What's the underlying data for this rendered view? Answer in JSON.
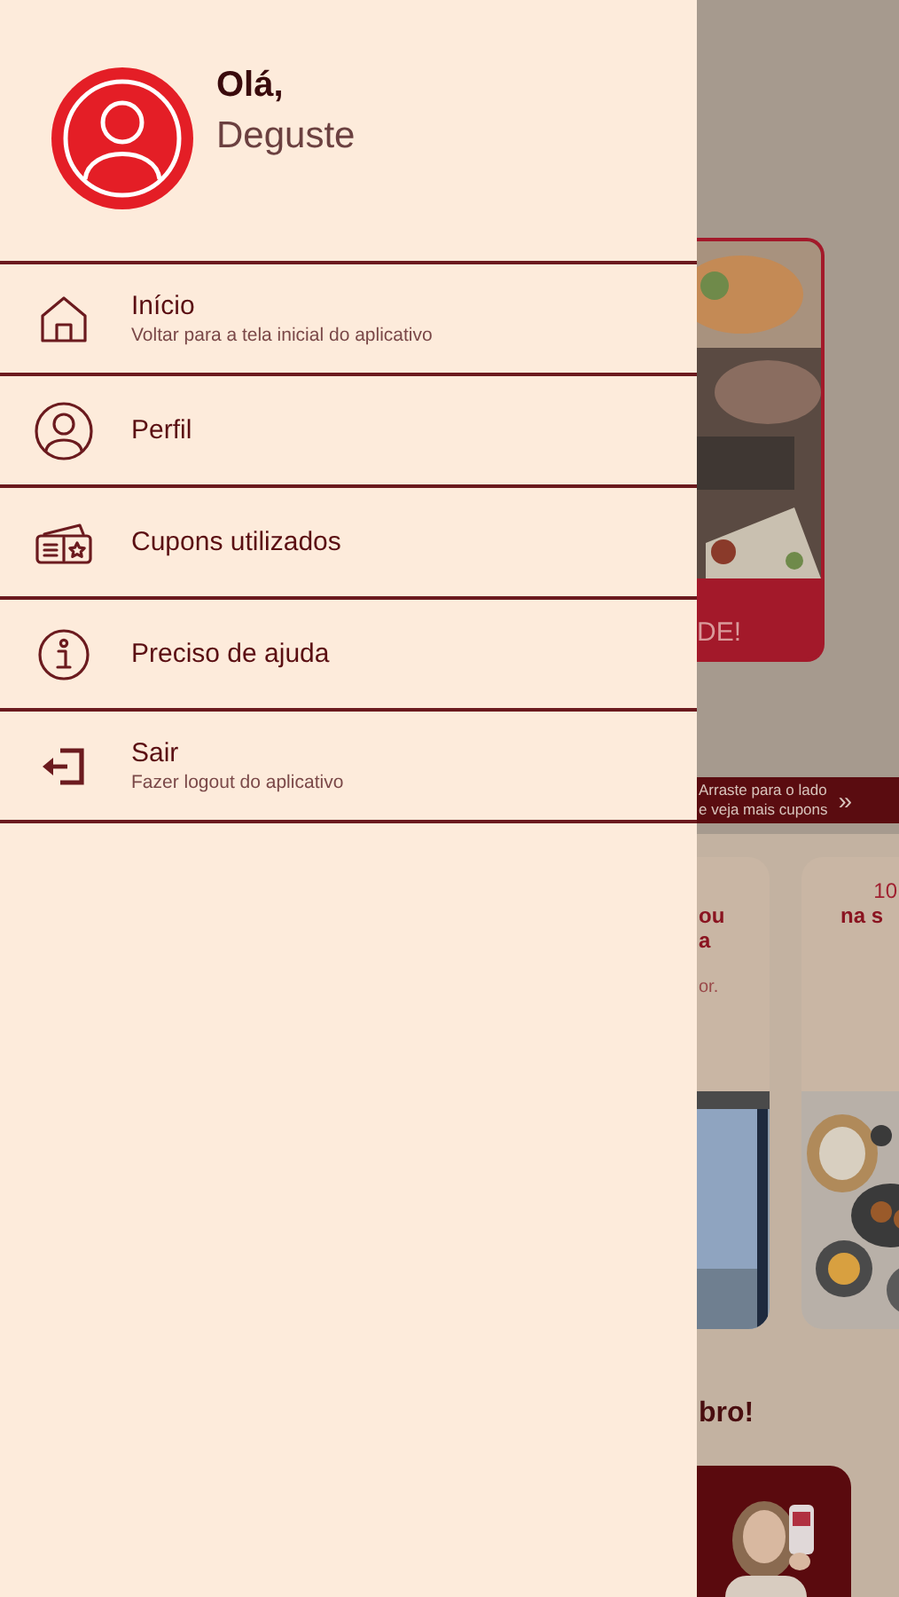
{
  "drawer": {
    "greeting": "Olá,",
    "user_name": "Deguste",
    "items": [
      {
        "kind": "home",
        "label": "Início",
        "subtitle": "Voltar para a tela inicial do aplicativo"
      },
      {
        "kind": "profile",
        "label": "Perfil"
      },
      {
        "kind": "coupons",
        "label": "Cupons utilizados"
      },
      {
        "kind": "info",
        "label": "Preciso de ajuda"
      },
      {
        "kind": "logout",
        "label": "Sair",
        "subtitle": "Fazer logout do aplicativo"
      }
    ]
  },
  "background": {
    "promo_card": {
      "caption": "DE!"
    },
    "swipe_hint": {
      "line_1": "Arraste para o lado",
      "line_2": "e veja mais cupons",
      "arrow": "»"
    },
    "offer_cards": [
      {
        "title_1": "ou",
        "title_2": "a",
        "body": "or."
      },
      {
        "title_1": "10",
        "title_2": "na s"
      }
    ],
    "section_title": "bro!"
  }
}
